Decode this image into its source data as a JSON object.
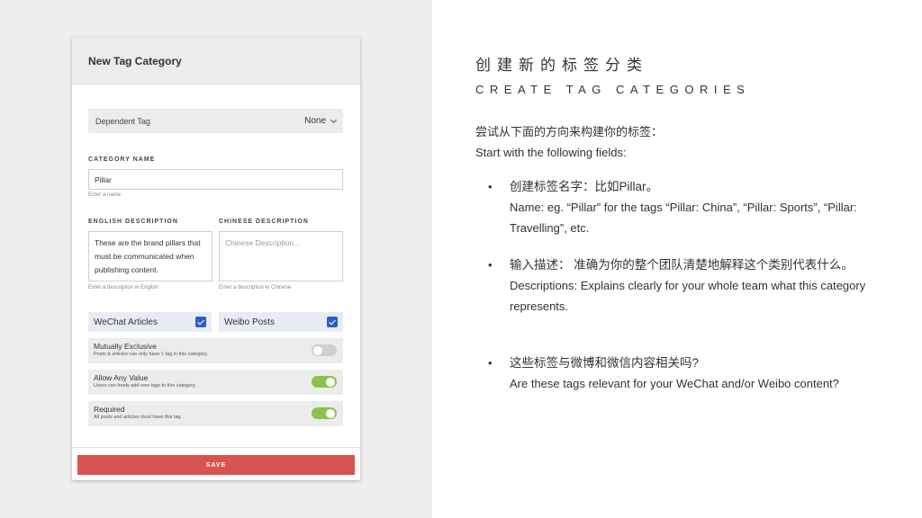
{
  "form": {
    "title": "New Tag Category",
    "dependent_tag_label": "Dependent Tag",
    "dependent_tag_value": "None",
    "category_name_label": "CATEGORY NAME",
    "category_name_value": "Pillar",
    "category_name_hint": "Enter a name",
    "english_desc_label": "ENGLISH DESCRIPTION",
    "english_desc_value": "These are the brand pillars that must be communicated when publishing content.",
    "english_desc_hint": "Enter a description in English",
    "chinese_desc_label": "CHINESE DESCRIPTION",
    "chinese_desc_placeholder": "Chinese Description...",
    "chinese_desc_hint": "Enter a description in Chinese",
    "wechat_label": "WeChat Articles",
    "wechat_checked": true,
    "weibo_label": "Weibo Posts",
    "weibo_checked": true,
    "toggles": [
      {
        "title": "Mutually Exclusive",
        "subtitle": "Posts & articles can only have 1 tag in this category.",
        "on": false
      },
      {
        "title": "Allow Any Value",
        "subtitle": "Users can freely add new tags to this category.",
        "on": true
      },
      {
        "title": "Required",
        "subtitle": "All posts and articles must have this tag.",
        "on": true
      }
    ],
    "save_label": "SAVE",
    "colors": {
      "save": "#d9534f",
      "toggle_on": "#8bc34a",
      "checkbox": "#2a5fbf"
    }
  },
  "slide": {
    "cn_title": "创建新的标签分类",
    "en_title": "CREATE TAG CATEGORIES",
    "intro_cn": "尝试从下面的方向来构建你的标签：",
    "intro_en": "Start with the following fields:",
    "bullets": [
      {
        "cn": "创建标签名字：比如Pillar。",
        "en": "Name: eg. “Pillar” for the tags “Pillar: China”, “Pillar: Sports”, “Pillar: Travelling”, etc."
      },
      {
        "cn": "输入描述： 准确为你的整个团队清楚地解释这个类别代表什么。",
        "en": "Descriptions: Explains clearly for your whole team what this category represents."
      },
      {
        "cn": "这些标签与微博和微信内容相关吗?",
        "en": "Are these tags relevant for your WeChat and/or Weibo content?"
      }
    ]
  }
}
